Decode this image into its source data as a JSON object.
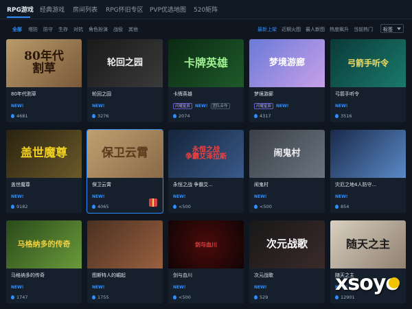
{
  "top_tabs": [
    {
      "label": "RPG游戏",
      "active": true
    },
    {
      "label": "经典游戏",
      "active": false
    },
    {
      "label": "房间列表",
      "active": false
    },
    {
      "label": "RPG怀旧专区",
      "active": false
    },
    {
      "label": "PVP优选地图",
      "active": false
    },
    {
      "label": "520矩阵",
      "active": false
    }
  ],
  "categories": [
    "全部",
    "塔防",
    "防守",
    "生存",
    "对抗",
    "角色扮演",
    "战役",
    "其他"
  ],
  "sort_options": [
    "最新上架",
    "近期火图",
    "最人新图",
    "热度飙升",
    "当前热门"
  ],
  "tag_select": "标签",
  "cards": [
    {
      "title": "80年代割草",
      "art": "80年代\n割草",
      "new": "NEW!",
      "tags": [],
      "count": "4681"
    },
    {
      "title": "轮回之园",
      "art": "轮回之园",
      "new": "NEW!",
      "tags": [],
      "count": "3276"
    },
    {
      "title": "卡牌英雄",
      "art": "卡牌英雄",
      "new": "NEW!",
      "tags": [
        "闪耀星辰",
        "团队合作"
      ],
      "count": "2074"
    },
    {
      "title": "梦境游廊",
      "art": "梦境游廊",
      "new": "NEW!",
      "tags": [
        "闪耀星辰"
      ],
      "count": "4317"
    },
    {
      "title": "弓箭手听令",
      "art": "弓箭手听令",
      "new": "NEW!",
      "tags": [],
      "count": "3516"
    },
    {
      "title": "盖世魔尊",
      "art": "盖世魔尊",
      "new": "NEW!",
      "tags": [],
      "count": "9182"
    },
    {
      "title": "保卫云霄",
      "art": "保卫云霄",
      "new": "NEW!",
      "tags": [],
      "count": "4065"
    },
    {
      "title": "永恒之战 争霸艾...",
      "art": "永恒之战\n争霸艾泽拉斯",
      "new": "NEW!",
      "tags": [],
      "count": "<500"
    },
    {
      "title": "闹鬼村",
      "art": "闹鬼村",
      "new": "NEW!",
      "tags": [],
      "count": "<500"
    },
    {
      "title": "灾厄之地4人防守...",
      "art": "",
      "new": "NEW!",
      "tags": [],
      "count": "854"
    },
    {
      "title": "马格纳多的传奇",
      "art": "马格纳多的传奇",
      "new": "NEW!",
      "tags": [],
      "count": "1747"
    },
    {
      "title": "图斯特人的崛起",
      "art": "",
      "new": "NEW!",
      "tags": [],
      "count": "1755"
    },
    {
      "title": "剑与血川",
      "art": "剑与血川",
      "new": "NEW!",
      "tags": [],
      "count": "<500"
    },
    {
      "title": "次元战歌",
      "art": "次元战歌",
      "new": "NEW!",
      "tags": [],
      "count": "529"
    },
    {
      "title": "随天之主",
      "art": "随天之主",
      "new": "NEW!",
      "tags": [],
      "count": "12901"
    }
  ],
  "watermark": "xsoyo",
  "colors": {
    "accent": "#2f8fff",
    "background": "#0f1620",
    "card": "#16202c"
  }
}
